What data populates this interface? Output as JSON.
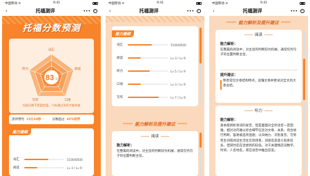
{
  "status": {
    "carrier": "中国移动 ≋",
    "time": "9:41",
    "battery_level": 0.6
  },
  "nav": {
    "title": "托福测评",
    "more": "•••"
  },
  "hero": {
    "title": "托福分数预测"
  },
  "radar": {
    "score": "83",
    "score_unit": "分",
    "axes": [
      "词汇",
      "阅读",
      "口语",
      "写作",
      "听力"
    ],
    "note": "托福分数不是固定值，只有通过测评才能知道",
    "accent": "#f7842a"
  },
  "stats": {
    "time_label": "测评用时",
    "time_value": "15分10秒",
    "rank_label": "分数超过",
    "rank_value": "45%同学"
  },
  "ability": {
    "title": "能力提纲",
    "rows": [
      {
        "label": "词汇",
        "value": "5100/8500",
        "ratio": 0.6
      },
      {
        "label": "阅读",
        "value": "Lv 3 / Lv 9",
        "ratio": 0.33
      },
      {
        "label": "听力",
        "value": "Lv 5 / Lv 9",
        "ratio": 0.55
      },
      {
        "label": "口语",
        "value": "Lv 3 / Lv 9",
        "ratio": 0.33
      },
      {
        "label": "写作",
        "value": "Lv 7 / Lv 9",
        "ratio": 0.78
      }
    ]
  },
  "advice": {
    "banner": "能力解析及提升建议",
    "reading_tab": "阅读",
    "listening_tab": "听力",
    "analysis_label": "能力解析：",
    "reading_analysis": "在整篇的阅读中，对主旨的判断较为机械，通常仅凭句子的位置判断主旨。",
    "suggestion_label": "提升建议：",
    "suggestion_text": "熟悉常见文章结构特点，读懂文章并尝试对全文的大意总结。",
    "listening_analysis": "基本能辨析单词的发音，但是面面对全听语音一定困难，相对对内难以综合细节信息对文章、关系、场合进行判断，容易被选项迷惑；以归纳力、识别发音，写到有生词或阅读生活生实际场景，词组及其意义就系较多，但同时还在话想到的较低，对于关键情态词数字、时间、人名地名，或在语音中推出答案。"
  }
}
